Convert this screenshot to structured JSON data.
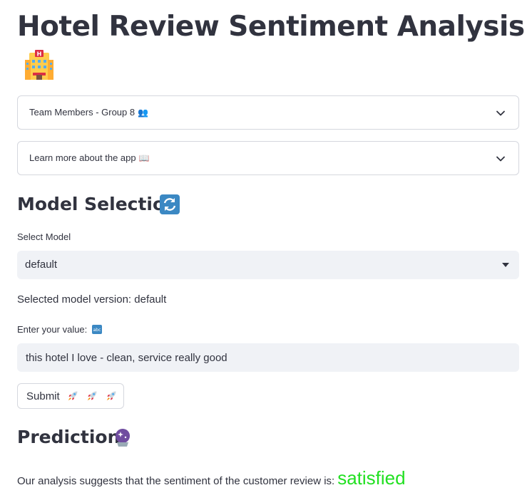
{
  "header": {
    "title": "Hotel Review Sentiment Analysis",
    "icon": "hotel-icon"
  },
  "expanders": [
    {
      "label": "Team Members - Group 8",
      "emoji": "👥"
    },
    {
      "label": "Learn more about the app",
      "emoji": "📖"
    }
  ],
  "model_section": {
    "heading": "Model Selection",
    "icon": "arrows-counterclockwise-icon",
    "select_label": "Select Model",
    "select_value": "default",
    "selected_text": "Selected model version: default"
  },
  "input_section": {
    "label": "Enter your value:",
    "label_icon": "abc-icon",
    "value": "this hotel I love - clean, service really good"
  },
  "submit": {
    "label": "Submit",
    "icons": [
      "rocket-icon",
      "rocket-icon",
      "rocket-icon"
    ]
  },
  "prediction": {
    "heading": "Prediction",
    "icon": "crystal-ball-icon",
    "text": "Our analysis suggests that the sentiment of the customer review is:",
    "sentiment": "satisfied",
    "sentiment_color": "#22e022"
  }
}
